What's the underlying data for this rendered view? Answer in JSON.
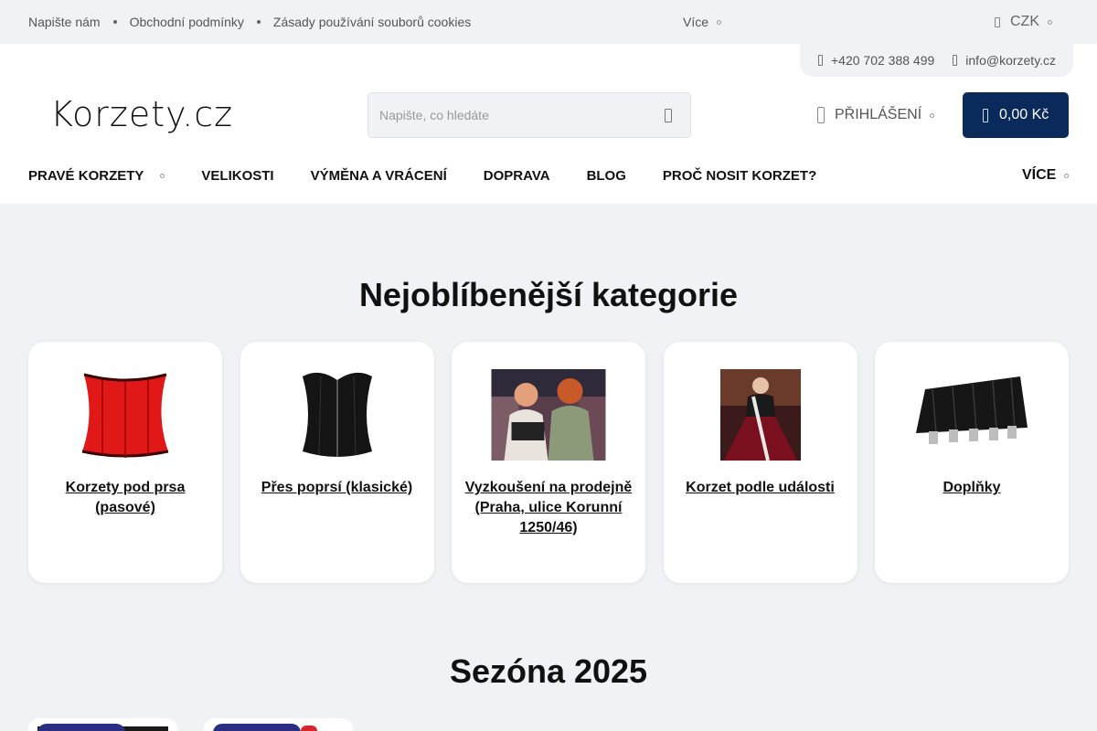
{
  "topbar": {
    "links": [
      "Napište nám",
      "Obchodní podmínky",
      "Zásady používání souborů cookies"
    ],
    "more_label": "Více",
    "currency": "CZK"
  },
  "contact": {
    "phone": "+420 702 388 499",
    "email": "info@korzety.cz"
  },
  "logo": {
    "text": "Korzety.cz"
  },
  "search": {
    "placeholder": "Napište, co hledáte",
    "icon": "search-icon"
  },
  "login": {
    "label": "PŘIHLÁŠENÍ",
    "icon": "user-icon"
  },
  "cart": {
    "total": "0,00 Kč",
    "icon": "cart-icon",
    "color": "#0b2a5c"
  },
  "nav": {
    "items": [
      "PRAVÉ KORZETY",
      "VELIKOSTI",
      "VÝMĚNA A VRÁCENÍ",
      "DOPRAVA",
      "BLOG",
      "PROČ NOSIT KORZET?"
    ],
    "more_label": "VÍCE"
  },
  "categories": {
    "title": "Nejoblíbenější kategorie",
    "items": [
      {
        "label": "Korzety pod prsa (pasové)"
      },
      {
        "label": "Přes poprsí (klasické)"
      },
      {
        "label": "Vyzkoušení na prodejně (Praha, ulice Korunní 1250/46)"
      },
      {
        "label": "Korzet podle události"
      },
      {
        "label": "Doplňky"
      }
    ]
  },
  "season": {
    "title": "Sezóna 2025"
  },
  "colors": {
    "background": "#f1f2f6",
    "accent": "#0b2a5c",
    "badge": "#2a2f83"
  }
}
